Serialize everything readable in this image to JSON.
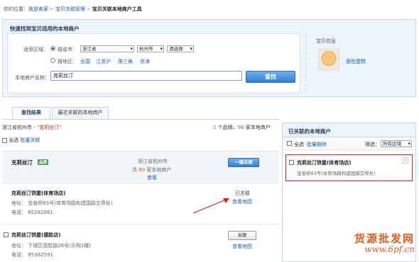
{
  "breadcrumb": {
    "prefix": "你的位置：",
    "items": [
      "我是卖家",
      "宝贝关联管理"
    ],
    "separator": ">",
    "current": "宝贝关联本地商户工具"
  },
  "search": {
    "title": "快速找到宝贝适用的本地商户",
    "region_label": "适用区域：",
    "by_city_label": "按省市：",
    "province": "浙江省",
    "city": "杭州市",
    "district": "请选择",
    "by_area_label": "按地区：",
    "areas": [
      "全国",
      "江浙沪",
      "珠三角",
      "京津"
    ],
    "merchant_label": "本地商户名称：",
    "merchant_value": "克莉丝汀",
    "search_button": "查找"
  },
  "product": {
    "title": "宝贝信息",
    "link": "面包蛋糕"
  },
  "tabs": [
    "查找结果",
    "最近关联的本地商户"
  ],
  "results": {
    "location": "浙江省杭州市 - ",
    "keyword": "\"克莉丝汀\"",
    "brand_count": "1",
    "brand_suffix": " 个品牌，",
    "merchant_count": "96",
    "merchant_suffix": " 家本地商户",
    "select_all": "全选",
    "batch_link": "批量关联"
  },
  "brand": {
    "name": "克莉丝汀",
    "badge": "品牌",
    "location": "浙江省杭州市",
    "count_prefix": "共 ",
    "count": "80",
    "count_suffix": " 家本地商户",
    "view": "查看",
    "button": "一键关联"
  },
  "stores": [
    {
      "name": "克莉丝汀饼屋(体育场店)",
      "address": "地址： 宝善桥83号(体育场路和建国路交界处)",
      "phone": "电话： 85282061",
      "status": "已关联",
      "map_link": "查看地图"
    },
    {
      "name": "克莉丝汀饼屋(德胜店)",
      "address": "地址： 下城区德胜路28号(乐购1楼)",
      "phone": "电话： 85382591",
      "button": "关联",
      "map_link": "查看地图"
    }
  ],
  "linked": {
    "title": "已关联的本地商户",
    "select_all": "全选",
    "batch_remove": "批量删除",
    "filter_label": "筛选：",
    "filter_value": "所有区域",
    "items": [
      {
        "name": "克莉丝汀饼屋(体育场店)",
        "address": "宝善桥83号(体育场路和建国路交界处)",
        "close": "×"
      }
    ]
  },
  "watermark": {
    "line1": "货源批发网",
    "line2": "www.6pf.cn"
  },
  "colors": {
    "accent": "#1a5fb4",
    "panel": "#eef4fb",
    "highlight_border": "#e02020",
    "arrow": "#e02020"
  }
}
